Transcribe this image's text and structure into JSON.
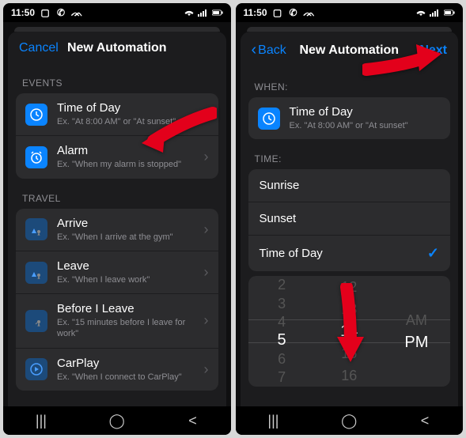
{
  "status": {
    "time": "11:50"
  },
  "left": {
    "nav": {
      "cancel": "Cancel",
      "title": "New Automation"
    },
    "events": {
      "header": "EVENTS",
      "timeOfDay": {
        "title": "Time of Day",
        "sub": "Ex. \"At 8:00 AM\" or \"At sunset\""
      },
      "alarm": {
        "title": "Alarm",
        "sub": "Ex. \"When my alarm is stopped\""
      }
    },
    "travel": {
      "header": "TRAVEL",
      "arrive": {
        "title": "Arrive",
        "sub": "Ex. \"When I arrive at the gym\""
      },
      "leave": {
        "title": "Leave",
        "sub": "Ex. \"When I leave work\""
      },
      "before": {
        "title": "Before I Leave",
        "sub": "Ex. \"15 minutes before I leave for work\""
      },
      "carplay": {
        "title": "CarPlay",
        "sub": "Ex. \"When I connect to CarPlay\""
      }
    }
  },
  "right": {
    "nav": {
      "back": "Back",
      "title": "New Automation",
      "next": "Next"
    },
    "when": {
      "header": "WHEN:",
      "timeOfDay": {
        "title": "Time of Day",
        "sub": "Ex. \"At 8:00 AM\" or \"At sunset\""
      }
    },
    "time": {
      "header": "TIME:",
      "sunrise": "Sunrise",
      "sunset": "Sunset",
      "timeOfDay": "Time of Day"
    },
    "picker": {
      "hours": [
        "2",
        "3",
        "4",
        "5",
        "6",
        "7"
      ],
      "minutes": [
        "12",
        "13",
        "14",
        "15",
        "16"
      ],
      "ampm": [
        "AM",
        "PM"
      ],
      "selHour": "5",
      "selMin": "14",
      "selAmPm": "PM"
    }
  },
  "colors": {
    "accent": "#0a84ff",
    "arrow": "#e3001b"
  }
}
